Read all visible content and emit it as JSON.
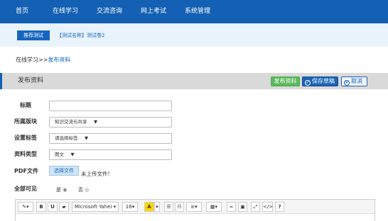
{
  "nav": {
    "home": "首页",
    "learning": "在线学习",
    "forum": "交流咨询",
    "exam": "网上考试",
    "admin": "系统管理"
  },
  "notice": {
    "tag": "推荐测试",
    "link": "【测试名称】测试卷2"
  },
  "breadcrumb": {
    "parent": "在线学习",
    "sep": ">>",
    "current": "发布资料"
  },
  "panel": {
    "title": "发布资料",
    "publish": "发布资料",
    "save_draft": "保存草稿",
    "cancel": "取消"
  },
  "form": {
    "title_label": "标题",
    "title_value": "",
    "section_label": "所属版块",
    "section_value": "知识交流与共享",
    "tag_label": "设置标签",
    "tag_value": "请选择标签",
    "type_label": "资料类型",
    "type_value": "图文",
    "pdf_label": "PDF文件",
    "pdf_button": "选择文件",
    "pdf_status": "未上传文件!",
    "visible_label": "全部可见",
    "visible_yes": "是",
    "visible_no": "否"
  },
  "toolbar": {
    "font": "Microsoft Yahei",
    "size": "16",
    "bold": "B",
    "underline": "U",
    "highlight": "A",
    "help": "?"
  }
}
